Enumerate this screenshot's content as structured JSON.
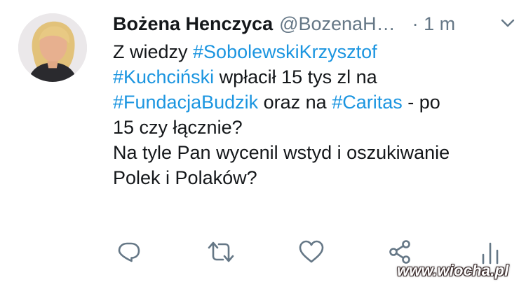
{
  "user": {
    "display_name": "Bożena Henczyca",
    "handle": "@BozenaH…",
    "time": "· 1 m",
    "avatar_icon": "profile-photo"
  },
  "tweet": {
    "lines": [
      [
        {
          "text": "Z wiedzy ",
          "hashtag": false
        },
        {
          "text": "#SobolewskiKrzysztof",
          "hashtag": true
        }
      ],
      [
        {
          "text": "#Kuchciński",
          "hashtag": true
        },
        {
          "text": " wpłacił 15 tys zl na",
          "hashtag": false
        }
      ],
      [
        {
          "text": "#FundacjaBudzik",
          "hashtag": true
        },
        {
          "text": " oraz na ",
          "hashtag": false
        },
        {
          "text": "#Caritas",
          "hashtag": true
        },
        {
          "text": " - po",
          "hashtag": false
        }
      ],
      [
        {
          "text": "15 czy łącznie?",
          "hashtag": false
        }
      ],
      [
        {
          "text": "Na tyle Pan wycenil wstyd i oszukiwanie",
          "hashtag": false
        }
      ],
      [
        {
          "text": "Polek i Polaków?",
          "hashtag": false
        }
      ]
    ]
  },
  "actions": [
    {
      "name": "reply-button",
      "icon": "reply-icon"
    },
    {
      "name": "retweet-button",
      "icon": "retweet-icon"
    },
    {
      "name": "like-button",
      "icon": "heart-icon"
    },
    {
      "name": "share-button",
      "icon": "share-icon"
    },
    {
      "name": "analytics-button",
      "icon": "analytics-icon"
    }
  ],
  "watermark": "www.wiocha.pl",
  "colors": {
    "hashtag": "#1b95e0",
    "secondary_text": "#657786",
    "icon": "#657786",
    "text": "#14171a"
  }
}
